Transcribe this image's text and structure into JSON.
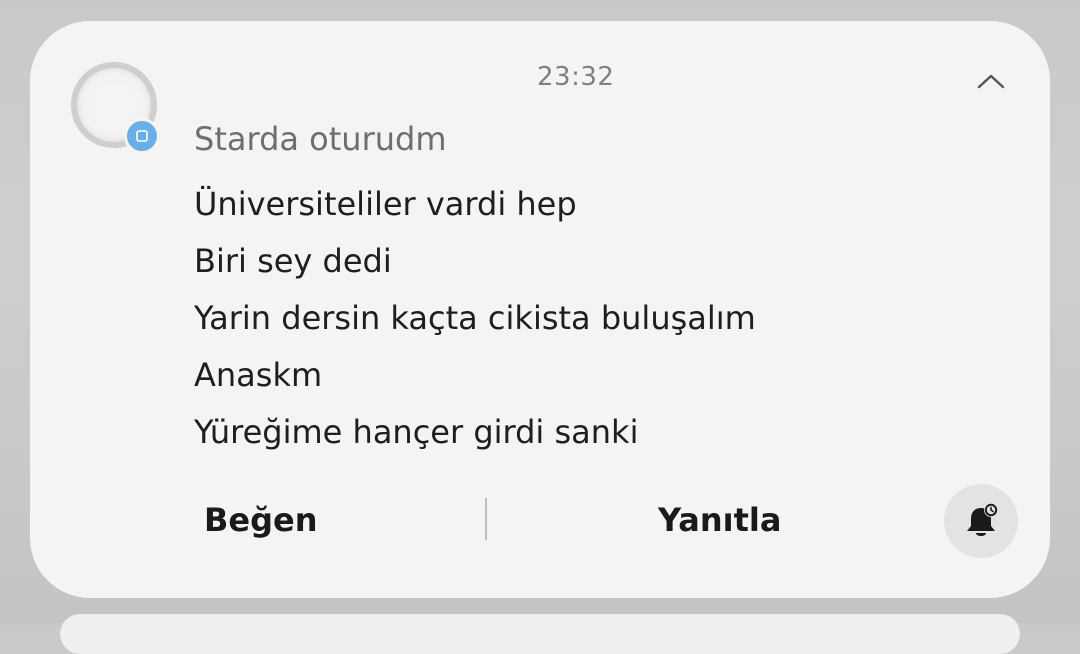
{
  "notification": {
    "time": "23:32",
    "sender": "Starda oturudm",
    "message_lines": [
      "Üniversiteliler vardi hep",
      "Biri sey dedi",
      "Yarin dersin kaçta cikista buluşalım",
      "Anaskm",
      "Yüreğime hançer girdi sanki"
    ],
    "actions": {
      "like_label": "Beğen",
      "reply_label": "Yanıtla"
    },
    "icons": {
      "avatar": "avatar-ring",
      "app_badge": "messaging-app-icon",
      "collapse": "chevron-up-icon",
      "snooze": "bell-snooze-icon"
    },
    "colors": {
      "card_background": "#f4f4f4",
      "badge": "#6aaee6",
      "text": "#1e1e1e",
      "secondary_text": "#6e6e6e"
    }
  }
}
